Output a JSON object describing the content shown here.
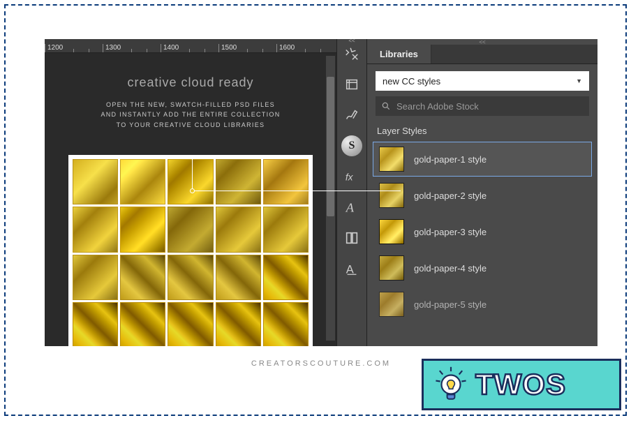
{
  "ruler": {
    "ticks": [
      "1200",
      "1300",
      "1400",
      "1500",
      "1600"
    ]
  },
  "promo": {
    "title": "creative cloud ready",
    "line1": "OPEN THE NEW, SWATCH-FILLED PSD FILES",
    "line2": "AND INSTANTLY ADD THE ENTIRE COLLECTION",
    "line3": "TO YOUR CREATIVE CLOUD LIBRARIES"
  },
  "toolbar": {
    "collapse": "<<",
    "icons": [
      "tools-icon",
      "history-icon",
      "brush-icon",
      "3d-icon",
      "fx-icon",
      "type-icon",
      "paragraph-icon",
      "align-icon"
    ],
    "three_d_label": "S"
  },
  "libraries": {
    "grip": "<<",
    "tab": "Libraries",
    "selector_value": "new CC styles",
    "search_placeholder": "Search Adobe Stock",
    "section_label": "Layer Styles",
    "styles": [
      {
        "label": "gold-paper-1 style",
        "selected": true
      },
      {
        "label": "gold-paper-2 style",
        "selected": false
      },
      {
        "label": "gold-paper-3 style",
        "selected": false
      },
      {
        "label": "gold-paper-4 style",
        "selected": false
      },
      {
        "label": "gold-paper-5 style",
        "selected": false
      }
    ]
  },
  "footer": {
    "url": "CREATORSCOUTURE.COM"
  },
  "badge": {
    "text": "TWOS"
  },
  "colors": {
    "panel_bg": "#4a4a4a",
    "accent_border": "#7aa9e6",
    "badge_bg": "#59d6cf",
    "badge_stroke": "#1a2e5c"
  }
}
